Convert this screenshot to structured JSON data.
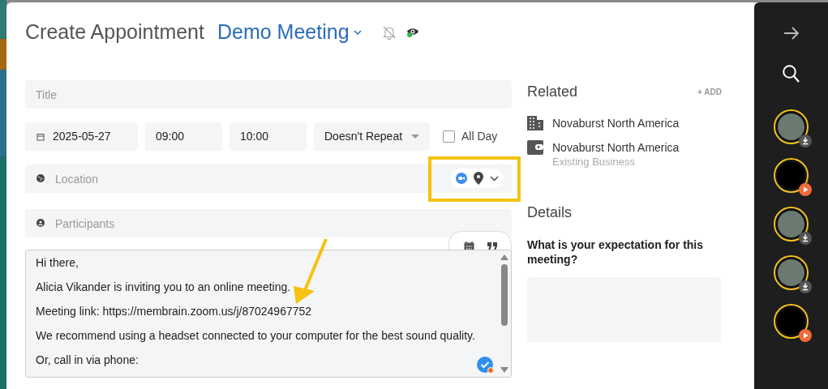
{
  "window": {
    "title": "Create Appointment",
    "appointment_type": "Demo Meeting"
  },
  "form": {
    "title": {
      "placeholder": "Title"
    },
    "date": "2025-05-27",
    "start_time": "09:00",
    "end_time": "10:00",
    "repeat": "Doesn't Repeat",
    "all_day": {
      "label": "All Day",
      "checked": false
    },
    "location": {
      "placeholder": "Location"
    },
    "participants": {
      "placeholder": "Participants"
    },
    "message_lines": [
      "Hi there,",
      "Alicia Vikander is inviting you to an online meeting.",
      "Meeting link: https://membrain.zoom.us/j/87024967752",
      "We recommend using a headset connected to your computer for the best sound quality.",
      "Or, call in via phone:"
    ]
  },
  "related": {
    "heading": "Related",
    "add_label": "+ ADD",
    "items": [
      {
        "kind": "company",
        "name": "Novaburst North America"
      },
      {
        "kind": "deal",
        "name": "Novaburst North America",
        "subtitle": "Existing Business"
      }
    ]
  },
  "details": {
    "heading": "Details",
    "question": "What is your expectation for this meeting?"
  },
  "sidebar": {
    "items": [
      {
        "kind": "download",
        "thumbnail": true
      },
      {
        "kind": "play",
        "thumbnail": false
      },
      {
        "kind": "download",
        "thumbnail": true
      },
      {
        "kind": "download",
        "thumbnail": true
      },
      {
        "kind": "play",
        "thumbnail": false
      }
    ]
  }
}
